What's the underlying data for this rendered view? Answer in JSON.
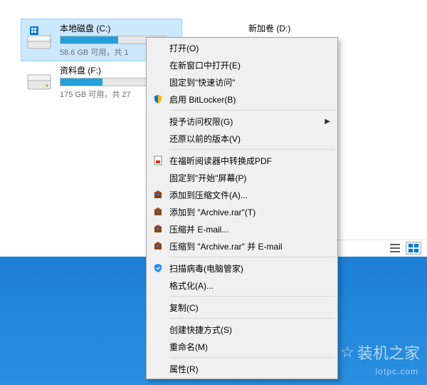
{
  "drives": {
    "c": {
      "label": "本地磁盘 (C:)",
      "sub": "58.6 GB 可用，共 1",
      "fill": 55
    },
    "d": {
      "label": "新加卷 (D:)",
      "sub": "",
      "fill": 0
    },
    "f": {
      "label": "资料盘 (F:)",
      "sub": "175 GB 可用，共 27",
      "fill": 40
    }
  },
  "menu": {
    "open": "打开(O)",
    "open_new_window": "在新窗口中打开(E)",
    "pin_quick": "固定到\"快速访问\"",
    "bitlocker": "启用 BitLocker(B)",
    "grant_access": "授予访问权限(G)",
    "restore_prev": "还原以前的版本(V)",
    "foxit_pdf": "在福昕阅读器中转换成PDF",
    "pin_start": "固定到\"开始\"屏幕(P)",
    "add_archive": "添加到压缩文件(A)...",
    "add_archive_rar": "添加到 \"Archive.rar\"(T)",
    "compress_email": "压缩并 E-mail...",
    "compress_to_email": "压缩到 \"Archive.rar\" 并 E-mail",
    "scan_virus": "扫描病毒(电脑管家)",
    "format": "格式化(A)...",
    "copy": "复制(C)",
    "create_shortcut": "创建快捷方式(S)",
    "rename": "重命名(M)",
    "properties": "属性(R)"
  },
  "watermark": {
    "text": "装机之家",
    "url": "lotpc.com"
  }
}
